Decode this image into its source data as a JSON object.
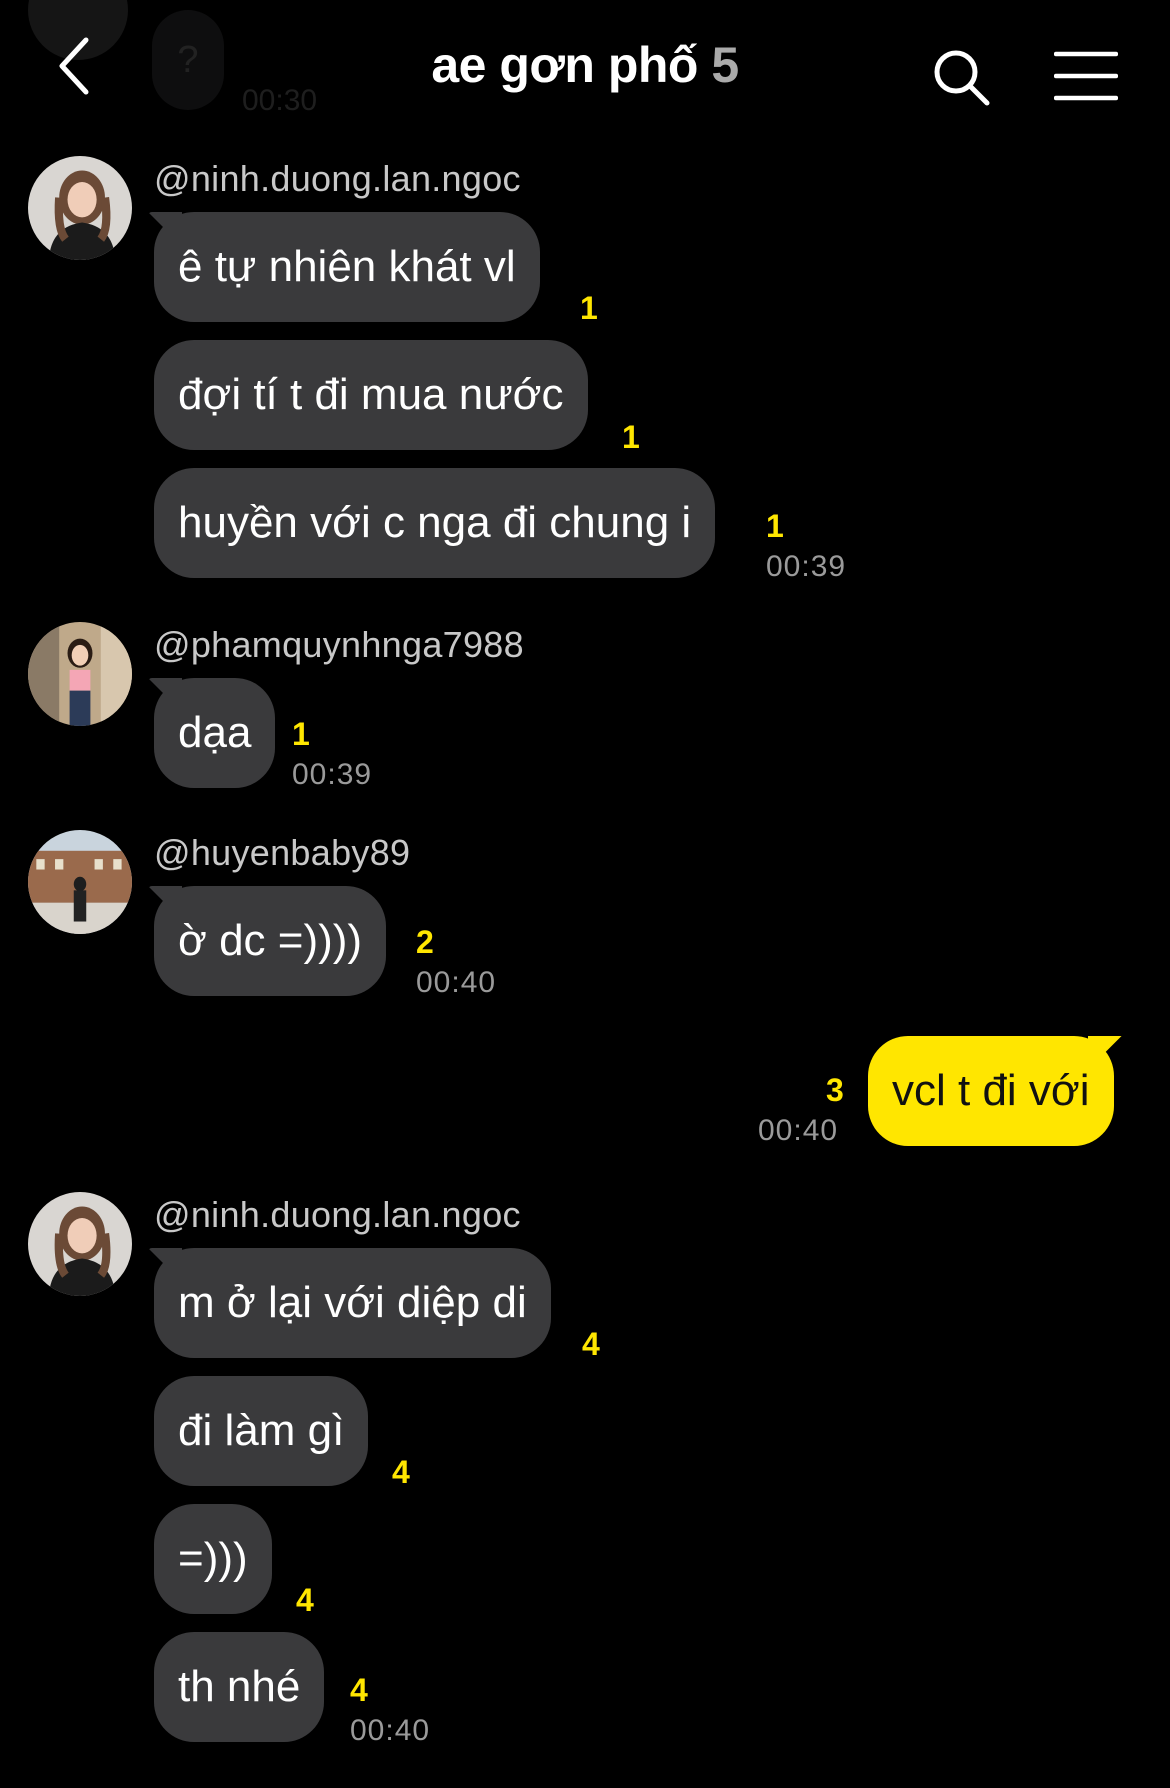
{
  "header": {
    "title": "ae gơn phố",
    "member_count": "5",
    "faded_bubble_text": "?",
    "faded_time": "00:30"
  },
  "messages": [
    {
      "username": "@ninh.duong.lan.ngoc",
      "text": "ê tự nhiên khát vl",
      "unread": "1"
    },
    {
      "text": "đợi tí t đi mua nước",
      "unread": "1"
    },
    {
      "text": "huyền với c nga đi chung i",
      "unread": "1",
      "time": "00:39"
    },
    {
      "username": "@phamquynhnga7988",
      "text": "dạa",
      "unread": "1",
      "time": "00:39"
    },
    {
      "username": "@huyenbaby89",
      "text": "ờ dc =))))",
      "unread": "2",
      "time": "00:40"
    },
    {
      "text": "vcl t đi với",
      "unread": "3",
      "time": "00:40",
      "mine": true
    },
    {
      "username": "@ninh.duong.lan.ngoc",
      "text": "m ở lại với diệp di",
      "unread": "4"
    },
    {
      "text": "đi làm gì",
      "unread": "4"
    },
    {
      "text": "=)))",
      "unread": "4"
    },
    {
      "text": "th nhé",
      "unread": "4",
      "time": "00:40"
    }
  ],
  "colors": {
    "background": "#000000",
    "bubble_other": "#3a3a3c",
    "bubble_mine": "#ffe600",
    "unread": "#ffe600",
    "timestamp": "#9a9a9a",
    "username": "#c8c8c8"
  },
  "icons": {
    "back": "chevron-left-icon",
    "search": "search-icon",
    "menu": "hamburger-menu-icon"
  }
}
